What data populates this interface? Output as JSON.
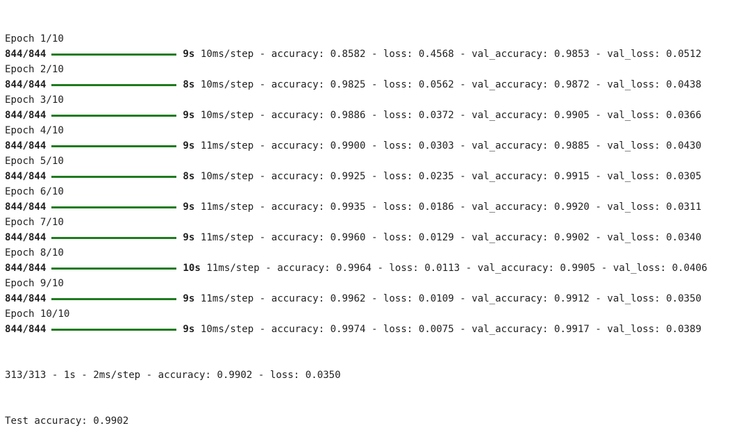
{
  "colors": {
    "text": "#212121",
    "progress_bar": "#1e7b1e",
    "background": "#ffffff"
  },
  "epochs": [
    {
      "header": "Epoch 1/10",
      "steps": "844/844",
      "time": "9s",
      "stats": "10ms/step - accuracy: 0.8582 - loss: 0.4568 - val_accuracy: 0.9853 - val_loss: 0.0512",
      "progress": 1.0
    },
    {
      "header": "Epoch 2/10",
      "steps": "844/844",
      "time": "8s",
      "stats": "10ms/step - accuracy: 0.9825 - loss: 0.0562 - val_accuracy: 0.9872 - val_loss: 0.0438",
      "progress": 1.0
    },
    {
      "header": "Epoch 3/10",
      "steps": "844/844",
      "time": "9s",
      "stats": "10ms/step - accuracy: 0.9886 - loss: 0.0372 - val_accuracy: 0.9905 - val_loss: 0.0366",
      "progress": 1.0
    },
    {
      "header": "Epoch 4/10",
      "steps": "844/844",
      "time": "9s",
      "stats": "11ms/step - accuracy: 0.9900 - loss: 0.0303 - val_accuracy: 0.9885 - val_loss: 0.0430",
      "progress": 1.0
    },
    {
      "header": "Epoch 5/10",
      "steps": "844/844",
      "time": "8s",
      "stats": "10ms/step - accuracy: 0.9925 - loss: 0.0235 - val_accuracy: 0.9915 - val_loss: 0.0305",
      "progress": 1.0
    },
    {
      "header": "Epoch 6/10",
      "steps": "844/844",
      "time": "9s",
      "stats": "11ms/step - accuracy: 0.9935 - loss: 0.0186 - val_accuracy: 0.9920 - val_loss: 0.0311",
      "progress": 1.0
    },
    {
      "header": "Epoch 7/10",
      "steps": "844/844",
      "time": "9s",
      "stats": "11ms/step - accuracy: 0.9960 - loss: 0.0129 - val_accuracy: 0.9902 - val_loss: 0.0340",
      "progress": 1.0
    },
    {
      "header": "Epoch 8/10",
      "steps": "844/844",
      "time": "10s",
      "stats": "11ms/step - accuracy: 0.9964 - loss: 0.0113 - val_accuracy: 0.9905 - val_loss: 0.0406",
      "progress": 1.0
    },
    {
      "header": "Epoch 9/10",
      "steps": "844/844",
      "time": "9s",
      "stats": "11ms/step - accuracy: 0.9962 - loss: 0.0109 - val_accuracy: 0.9912 - val_loss: 0.0350",
      "progress": 1.0
    },
    {
      "header": "Epoch 10/10",
      "steps": "844/844",
      "time": "9s",
      "stats": "10ms/step - accuracy: 0.9974 - loss: 0.0075 - val_accuracy: 0.9917 - val_loss: 0.0389",
      "progress": 1.0
    }
  ],
  "evaluation_line": "313/313 - 1s - 2ms/step - accuracy: 0.9902 - loss: 0.0350",
  "test_accuracy_line": "Test accuracy: 0.9902"
}
